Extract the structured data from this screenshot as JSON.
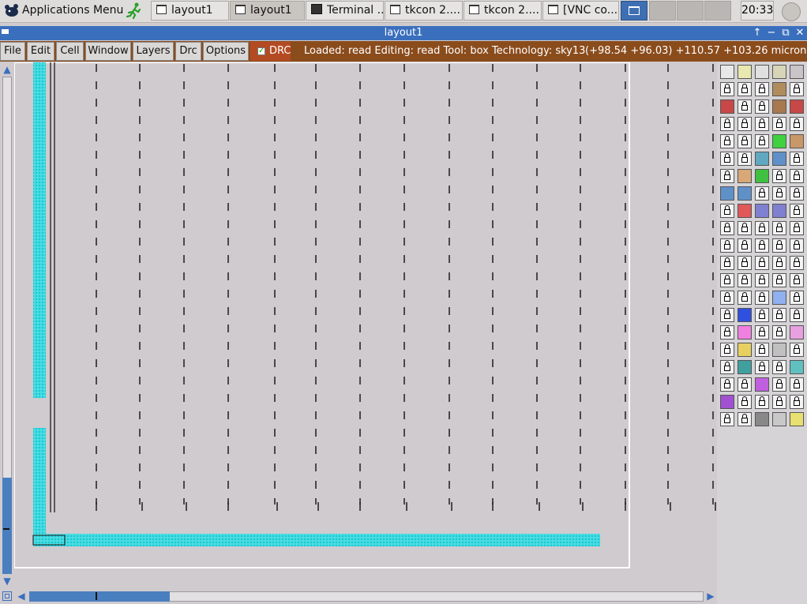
{
  "taskbar": {
    "app_menu_label": "Applications Menu",
    "tasks": [
      {
        "label": "layout1",
        "icon": "window-icon",
        "active": false
      },
      {
        "label": "layout1",
        "icon": "window-icon",
        "active": true
      },
      {
        "label": "Terminal ...",
        "icon": "terminal-icon",
        "active": false
      },
      {
        "label": "tkcon 2....",
        "icon": "window-icon",
        "active": false
      },
      {
        "label": "tkcon 2....",
        "icon": "window-icon",
        "active": false
      },
      {
        "label": "[VNC co...",
        "icon": "window-icon",
        "active": false
      }
    ],
    "clock": "20:33"
  },
  "window": {
    "title": "layout1",
    "controls": [
      "↑",
      "−",
      "⧉",
      "✕"
    ]
  },
  "menubar": {
    "items": [
      "File",
      "Edit",
      "Cell",
      "Window",
      "Layers",
      "Drc",
      "Options"
    ],
    "drc_toggle": {
      "label": "DRC",
      "checked": true
    }
  },
  "status": {
    "text": "Loaded: read  Editing: read  Tool: box   Technology: sky13",
    "coords": "(+98.54 +96.03) +110.57 +103.26 microns"
  },
  "colors": {
    "menubar_bg": "#8b4c1c",
    "titlebar_bg": "#3a6fbd",
    "drc_bg": "#b34a22",
    "canvas_bg": "#cfcbcf",
    "metal_cyan": "#39e4e8",
    "scroll_thumb": "#4a7fbf"
  },
  "palette": {
    "rows": [
      [
        "#e8e8e8",
        "#e8e8b0",
        "#e0e0e0",
        "#d8d4b8",
        "#c8c4c8"
      ],
      [
        "lock",
        "lock",
        "lock",
        "#b08c5c",
        "lock"
      ],
      [
        "#c84848",
        "lock",
        "lock",
        "#a87850",
        "#c84848"
      ],
      [
        "lock",
        "lock",
        "lock",
        "lock",
        "lock"
      ],
      [
        "lock",
        "lock",
        "lock",
        "#40d040",
        "#c89868"
      ],
      [
        "lock",
        "lock",
        "#60a8c0",
        "#6090c8",
        "lock"
      ],
      [
        "lock",
        "#d8a878",
        "#40c040",
        "lock",
        "lock"
      ],
      [
        "#6090c8",
        "#6090c8",
        "lock",
        "lock",
        "lock"
      ],
      [
        "lock",
        "#e05858",
        "#8080d0",
        "#8080d0",
        "lock"
      ],
      [
        "lock",
        "lock",
        "lock",
        "lock",
        "lock"
      ],
      [
        "lock",
        "lock",
        "lock",
        "lock",
        "lock"
      ],
      [
        "lock",
        "lock",
        "lock",
        "lock",
        "lock"
      ],
      [
        "lock",
        "lock",
        "lock",
        "lock",
        "lock"
      ],
      [
        "lock",
        "lock",
        "lock",
        "#90b0f0",
        "lock"
      ],
      [
        "lock",
        "#3050e0",
        "lock",
        "lock",
        "lock"
      ],
      [
        "lock",
        "#f080e0",
        "lock",
        "lock",
        "#e8a0e0"
      ],
      [
        "lock",
        "#e8d060",
        "lock",
        "#c0c0c0",
        "lock"
      ],
      [
        "lock",
        "#40a0a0",
        "lock",
        "lock",
        "#60c0c0"
      ],
      [
        "lock",
        "lock",
        "#c060e0",
        "lock",
        "lock"
      ],
      [
        "#a050d0",
        "lock",
        "lock",
        "lock",
        "lock"
      ],
      [
        "lock",
        "lock",
        "#888888",
        "#c8c8c8",
        "#e8e070"
      ]
    ]
  }
}
